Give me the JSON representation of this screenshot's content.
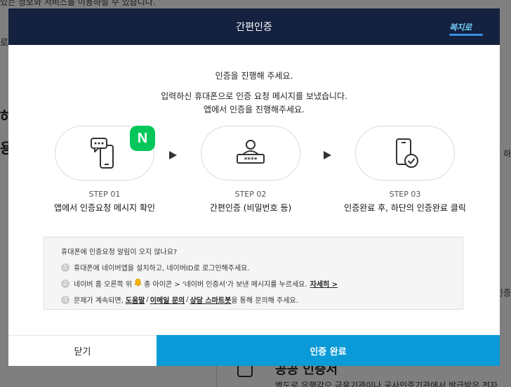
{
  "background": {
    "top_text": "있는 정보와 서비스를 이용하실 수 있습니다.",
    "left_text_1": "로",
    "left_text_2": "하",
    "left_text_3": "용",
    "right_text_1": "하",
    "right_text_2": "인증",
    "bottom_title": "공공 인증서",
    "bottom_text": "별도로 은행감으 금융기관이나 공사인증기관에서 발급받은 전자"
  },
  "modal": {
    "title": "간편인증",
    "brand": "복지로",
    "intro": {
      "line1": "인증을 진행해 주세요.",
      "line2": "입력하신 휴대폰으로 인증 요청 메시지를 보냈습니다.",
      "line3": "앱에서 인증을 진행해주세요."
    },
    "steps": [
      {
        "label": "STEP 01",
        "desc": "앱에서 인증요청 메시지 확인",
        "icon": "phone-message-icon"
      },
      {
        "label": "STEP 02",
        "desc": "간편인증 (비밀번호 등)",
        "icon": "user-password-icon"
      },
      {
        "label": "STEP 03",
        "desc": "인증완료 후, 하단의 인증완료 클릭",
        "icon": "phone-check-icon"
      }
    ],
    "naver_badge": "N",
    "info": {
      "title": "휴대폰에 인증요청 알림이 오지 않나요?",
      "item1": {
        "num": "1",
        "text": "휴대폰에 네이버앱을 설치하고, 네이버ID로 로그인해주세요."
      },
      "item2": {
        "num": "2",
        "text_a": "네이버 홈 오른쪽 위",
        "text_b": "종 아이콘 > '네이버 인증서'가 보낸 메시지를 누르세요.",
        "link": "자세히 >"
      },
      "item3": {
        "num": "3",
        "text_a": "문제가 계속되면,",
        "link1": "도움말",
        "sep1": "/",
        "link2": "이메일 문의",
        "sep2": "/",
        "link3": "상담 스마트봇",
        "text_b": "을 통해 문의해 주세요."
      }
    },
    "buttons": {
      "close": "닫기",
      "done": "인증 완료"
    }
  },
  "colors": {
    "header_bg": "#14213f",
    "primary": "#0a9ad7",
    "naver_green": "#03c75a"
  }
}
